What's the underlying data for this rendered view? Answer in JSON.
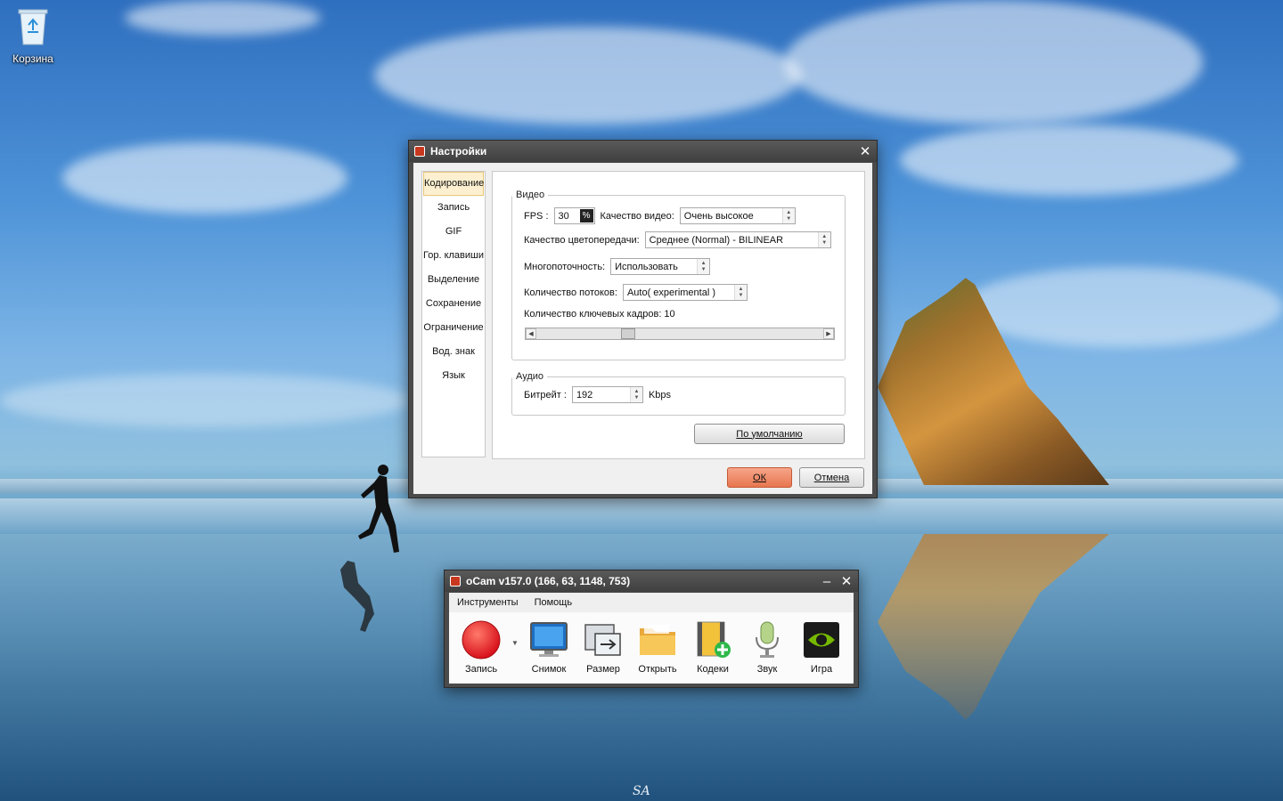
{
  "desktop": {
    "recycle_bin_label": "Корзина",
    "watermark": "SA"
  },
  "settings_window": {
    "title": "Настройки",
    "nav_items": [
      "Кодирование",
      "Запись",
      "GIF",
      "Гор. клавиши",
      "Выделение",
      "Сохранение",
      "Ограничение",
      "Вод. знак",
      "Язык"
    ],
    "active_nav": "Кодирование",
    "video": {
      "legend": "Видео",
      "fps_label": "FPS :",
      "fps_value": "30",
      "quality_label": "Качество видео:",
      "quality_value": "Очень высокое",
      "color_label": "Качество цветопередачи:",
      "color_value": "Среднее (Normal) - BILINEAR",
      "multithread_label": "Многопоточность:",
      "multithread_value": "Использовать",
      "threads_label": "Количество потоков:",
      "threads_value": "Auto( experimental )",
      "keyframes_label": "Количество ключевых кадров: 10",
      "keyframes_value": 10
    },
    "audio": {
      "legend": "Аудио",
      "bitrate_label": "Битрейт :",
      "bitrate_value": "192",
      "bitrate_unit": "Kbps"
    },
    "default_button": "По умолчанию",
    "ok_button": "ОК",
    "cancel_button": "Отмена"
  },
  "ocam_window": {
    "title": "oCam v157.0 (166, 63, 1148, 753)",
    "menu": [
      "Инструменты",
      "Помощь"
    ],
    "tools": [
      {
        "label": "Запись",
        "icon": "record-icon"
      },
      {
        "label": "Снимок",
        "icon": "monitor-icon"
      },
      {
        "label": "Размер",
        "icon": "resize-icon"
      },
      {
        "label": "Открыть",
        "icon": "folder-icon"
      },
      {
        "label": "Кодеки",
        "icon": "codec-icon"
      },
      {
        "label": "Звук",
        "icon": "microphone-icon"
      },
      {
        "label": "Игра",
        "icon": "nvidia-icon"
      }
    ]
  },
  "colors": {
    "ok_button": "#e8764f",
    "title_bar": "#3f3f3f",
    "record": "#e02020"
  }
}
